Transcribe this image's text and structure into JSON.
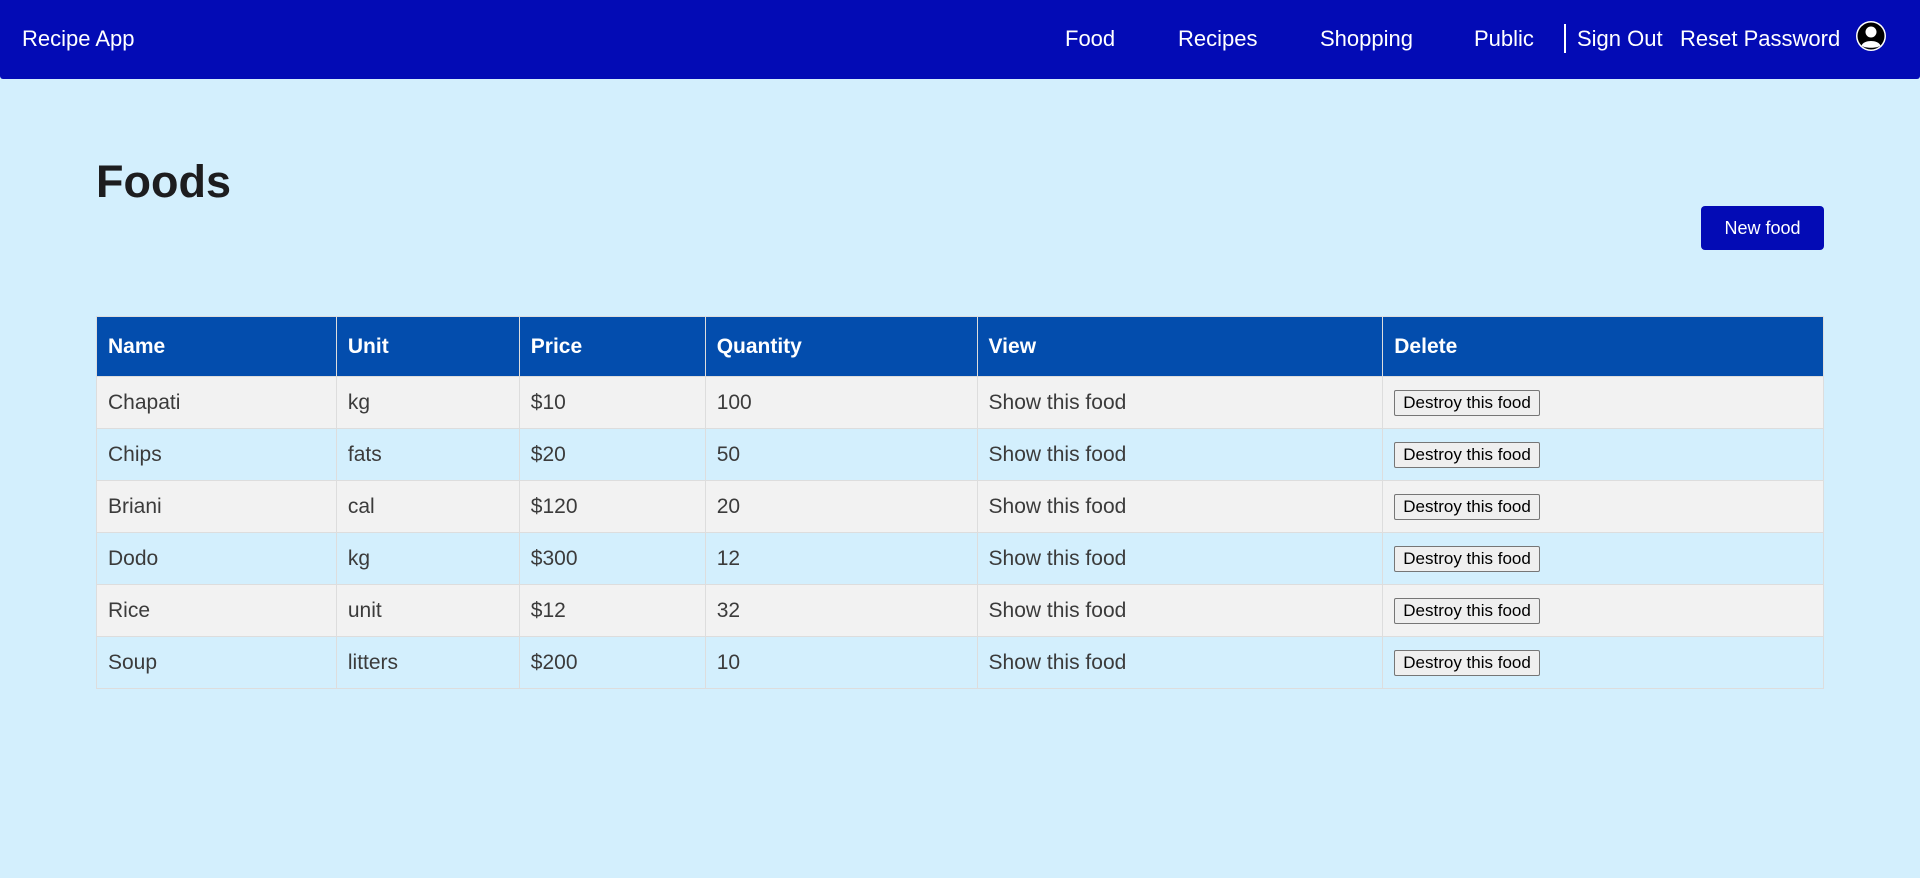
{
  "nav": {
    "brand": "Recipe App",
    "links": [
      {
        "label": "Food"
      },
      {
        "label": "Recipes"
      },
      {
        "label": "Shopping"
      },
      {
        "label": "Public"
      }
    ],
    "sign_out": "Sign Out",
    "reset_password": "Reset Password",
    "avatar_icon": "user-circle-icon"
  },
  "page": {
    "title": "Foods",
    "new_button": "New food"
  },
  "table": {
    "headers": [
      "Name",
      "Unit",
      "Price",
      "Quantity",
      "View",
      "Delete"
    ],
    "rows": [
      {
        "name": "Chapati",
        "unit": "kg",
        "price": "$10",
        "quantity": "100",
        "view": "Show this food",
        "delete": "Destroy this food"
      },
      {
        "name": "Chips",
        "unit": "fats",
        "price": "$20",
        "quantity": "50",
        "view": "Show this food",
        "delete": "Destroy this food"
      },
      {
        "name": "Briani",
        "unit": "cal",
        "price": "$120",
        "quantity": "20",
        "view": "Show this food",
        "delete": "Destroy this food"
      },
      {
        "name": "Dodo",
        "unit": "kg",
        "price": "$300",
        "quantity": "12",
        "view": "Show this food",
        "delete": "Destroy this food"
      },
      {
        "name": "Rice",
        "unit": "unit",
        "price": "$12",
        "quantity": "32",
        "view": "Show this food",
        "delete": "Destroy this food"
      },
      {
        "name": "Soup",
        "unit": "litters",
        "price": "$200",
        "quantity": "10",
        "view": "Show this food",
        "delete": "Destroy this food"
      }
    ]
  },
  "colors": {
    "navbar": "#030bb5",
    "header_row": "#034dad",
    "background": "#d3effd",
    "row_alt": "#f2f2f2"
  }
}
